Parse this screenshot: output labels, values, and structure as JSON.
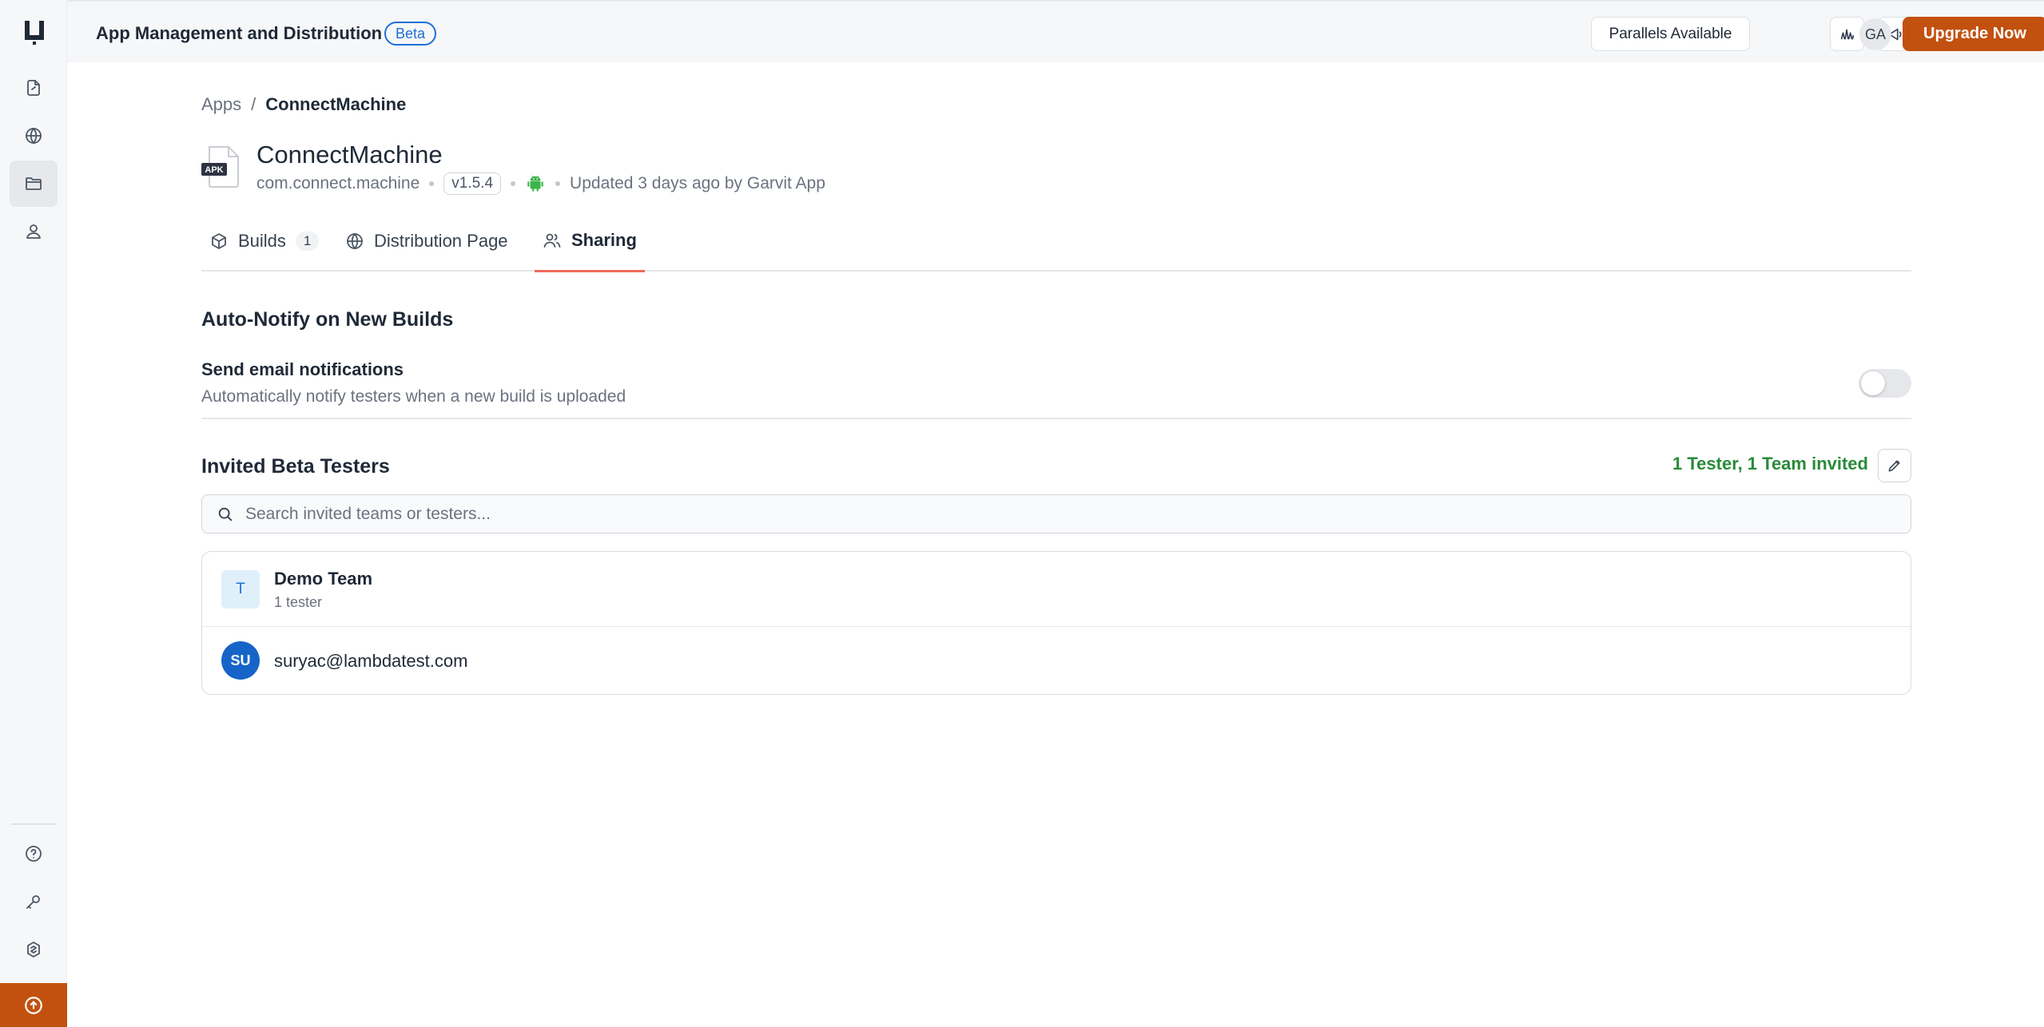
{
  "header": {
    "title": "App Management and Distribution",
    "badge": "Beta",
    "parallels_label": "Parallels Available",
    "avatar_initials": "GA",
    "upgrade_label": "Upgrade Now",
    "icons": [
      "signal-icon",
      "megaphone-icon"
    ]
  },
  "sidebar": {
    "items": [
      {
        "name": "app-file-icon",
        "active": false
      },
      {
        "name": "globe-icon",
        "active": false
      },
      {
        "name": "folder-icon",
        "active": true
      },
      {
        "name": "user-icon",
        "active": false
      }
    ],
    "bottom_items": [
      "help-icon",
      "key-icon",
      "settings-icon",
      "upgrade-arrow-icon"
    ]
  },
  "breadcrumb": {
    "root": "Apps",
    "separator": "/",
    "current": "ConnectMachine"
  },
  "app": {
    "file_badge": "APK",
    "name": "ConnectMachine",
    "package": "com.connect.machine",
    "version": "v1.5.4",
    "platform_icon": "android-icon",
    "updated": "Updated 3 days ago by Garvit App"
  },
  "tabs": [
    {
      "label": "Builds",
      "count": "1",
      "icon": "cube-icon"
    },
    {
      "label": "Distribution Page",
      "icon": "globe-icon"
    },
    {
      "label": "Sharing",
      "icon": "users-icon",
      "active": true
    }
  ],
  "auto_notify": {
    "title": "Auto-Notify on New Builds",
    "setting_label": "Send email notifications",
    "setting_desc": "Automatically notify testers when a new build is uploaded",
    "enabled": false
  },
  "invited": {
    "title": "Invited Beta Testers",
    "summary": "1 Tester, 1 Team invited",
    "search_placeholder": "Search invited teams or testers...",
    "team": {
      "initial": "T",
      "name": "Demo Team",
      "count": "1 tester"
    },
    "tester": {
      "initials": "SU",
      "email": "suryac@lambdatest.com"
    }
  },
  "colors": {
    "brand": "#c2510f",
    "accent_blue": "#1d6fd6",
    "success_green": "#2a8a3a",
    "tab_underline": "#ef6a5a"
  }
}
